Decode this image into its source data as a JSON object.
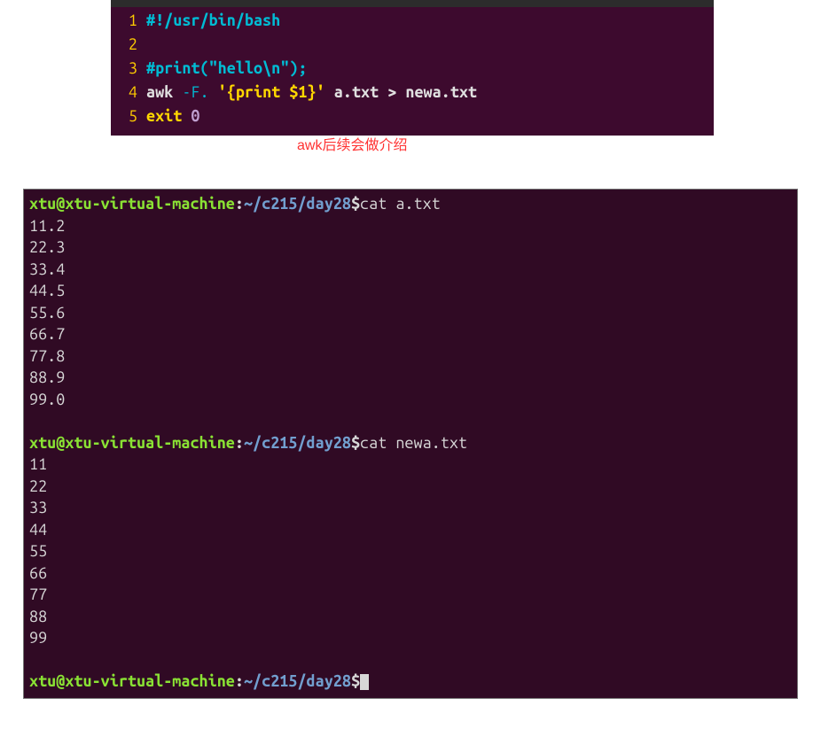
{
  "editor": {
    "lines": [
      {
        "no": "1",
        "tokens": [
          {
            "cls": "c-comment",
            "t": "#!/usr/bin/bash"
          }
        ]
      },
      {
        "no": "2",
        "tokens": []
      },
      {
        "no": "3",
        "tokens": [
          {
            "cls": "c-comment",
            "t": "#print(\"hello\\n\");"
          }
        ]
      },
      {
        "no": "4",
        "tokens": [
          {
            "cls": "c-plain",
            "t": "awk "
          },
          {
            "cls": "c-teal",
            "t": "-F."
          },
          {
            "cls": "c-plain",
            "t": " "
          },
          {
            "cls": "c-yellow",
            "t": "'{print $1}'"
          },
          {
            "cls": "c-plain",
            "t": " a.txt > newa.txt"
          }
        ]
      },
      {
        "no": "5",
        "tokens": [
          {
            "cls": "c-yellow",
            "t": "exit"
          },
          {
            "cls": "c-plain",
            "t": " "
          },
          {
            "cls": "c-num",
            "t": "0"
          }
        ]
      }
    ],
    "annotation": "awk后续会做介绍"
  },
  "terminal": {
    "user": "xtu",
    "host": "xtu-virtual-machine",
    "path": "~/c215/day28",
    "commands": [
      {
        "cmd": "cat a.txt",
        "output": [
          "11.2",
          "22.3",
          "33.4",
          "44.5",
          "55.6",
          "66.7",
          "77.8",
          "88.9",
          "99.0",
          ""
        ]
      },
      {
        "cmd": "cat newa.txt",
        "output": [
          "11",
          "22",
          "33",
          "44",
          "55",
          "66",
          "77",
          "88",
          "99",
          ""
        ]
      },
      {
        "cmd": "",
        "output": null
      }
    ]
  }
}
